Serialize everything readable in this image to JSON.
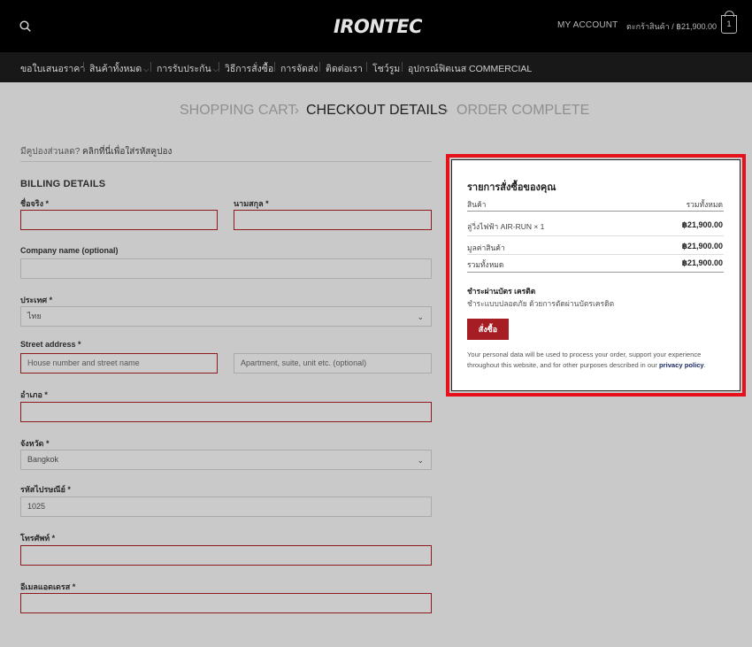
{
  "header": {
    "logo_text": "IRONTEC",
    "my_account": "MY ACCOUNT",
    "cart_label": "ตะกร้าสินค้า / ฿21,900.00",
    "cart_count": "1"
  },
  "nav": {
    "items": [
      {
        "label": "ขอใบเสนอราคา"
      },
      {
        "label": "สินค้าทั้งหมด"
      },
      {
        "label": "การรับประกัน"
      },
      {
        "label": "วิธีการสั่งซื้อ"
      },
      {
        "label": "การจัดส่ง"
      },
      {
        "label": "ติดต่อเรา"
      },
      {
        "label": "โชว์รูม"
      },
      {
        "label": "อุปกรณ์ฟิตเนส COMMERCIAL"
      }
    ],
    "dropdown_chevron": "⌵"
  },
  "breadcrumb": {
    "steps": [
      "SHOPPING CART",
      "CHECKOUT DETAILS",
      "ORDER COMPLETE"
    ],
    "separator": "›"
  },
  "coupon": {
    "text": "มีคูปองส่วนลด?",
    "link": "คลิกที่นี่เพื่อใส่รหัสคูปอง"
  },
  "billing": {
    "title": "BILLING DETAILS",
    "first_name_label": "ชื่อจริง *",
    "last_name_label": "นามสกุล *",
    "company_label": "Company name (optional)",
    "country_label": "ประเทศ *",
    "country_value": "ไทย",
    "street_label": "Street address *",
    "street_placeholder": "House number and street name",
    "street2_placeholder": "Apartment, suite, unit etc. (optional)",
    "district_label": "อำเภอ *",
    "province_label": "จังหวัด *",
    "province_value": "Bangkok",
    "postcode_label": "รหัสไปรษณีย์ *",
    "postcode_value": "1025",
    "phone_label": "โทรศัพท์ *",
    "email_label": "อีเมลแอดเดรส *"
  },
  "order": {
    "title": "รายการสั่งซื้อของคุณ",
    "col_product": "สินค้า",
    "col_total": "รวมทั้งหมด",
    "item_name": "ลู่วิ่งไฟฟ้า AIR-RUN  × 1",
    "item_price": "฿21,900.00",
    "subtotal_label": "มูลค่าสินค้า",
    "subtotal_value": "฿21,900.00",
    "total_label": "รวมทั้งหมด",
    "total_value": "฿21,900.00",
    "payment_title": "ชำระผ่านบัตร เครดิต",
    "payment_desc": "ชำระแบบปลอดภัย ด้วยการตัดผ่านบัตรเครดิต",
    "place_order": "สั่งซื้อ",
    "privacy_note": "Your personal data will be used to process your order, support your experience throughout this website, and for other purposes described in our",
    "privacy_link": "privacy policy",
    "privacy_end": "."
  },
  "colors": {
    "accent": "#a71d24",
    "highlight": "#e8101a",
    "header_bg": "#000000",
    "nav_bg": "#181818"
  },
  "icons": [
    "search-icon",
    "cart-icon",
    "chevron-down-icon"
  ]
}
